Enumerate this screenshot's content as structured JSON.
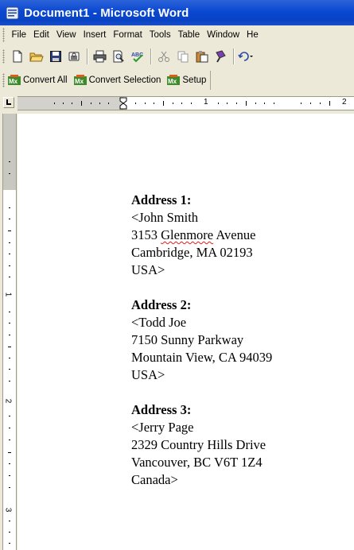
{
  "window": {
    "title": "Document1 - Microsoft Word"
  },
  "menu": [
    "File",
    "Edit",
    "View",
    "Insert",
    "Format",
    "Tools",
    "Table",
    "Window",
    "He"
  ],
  "toolbar": {
    "icons": [
      "new-document-icon",
      "open-folder-icon",
      "save-icon",
      "permission-icon",
      "print-icon",
      "print-preview-icon",
      "spelling-icon",
      "cut-icon",
      "copy-icon",
      "paste-icon",
      "format-painter-icon",
      "undo-icon"
    ]
  },
  "convert_toolbar": {
    "convert_all": "Convert All",
    "convert_selection": "Convert Selection",
    "setup": "Setup"
  },
  "ruler": {
    "label_1": "1",
    "label_2": "2",
    "vlabel_1": "1",
    "vlabel_2": "2",
    "vlabel_3": "3"
  },
  "document": {
    "addresses": [
      {
        "heading": "Address 1:",
        "lines": [
          "<John Smith",
          "3153 Glenmore Avenue",
          "Cambridge, MA 02193",
          "USA>"
        ]
      },
      {
        "heading": "Address 2:",
        "lines": [
          "<Todd Joe",
          "7150 Sunny Parkway",
          "Mountain View, CA 94039",
          "USA>"
        ]
      },
      {
        "heading": "Address 3:",
        "lines": [
          "<Jerry Page",
          "2329 Country Hills Drive",
          "Vancouver, BC V6T 1Z4",
          "Canada>"
        ]
      }
    ],
    "addr1_street_num": "3153 ",
    "addr1_street_name": "Glenmore",
    "addr1_street_suffix": " Avenue"
  },
  "colors": {
    "title_bar": "#0a48d2",
    "chrome": "#ece9d8",
    "spell_error": "#e31a1a",
    "convert_icon": "#3c8c2c"
  }
}
